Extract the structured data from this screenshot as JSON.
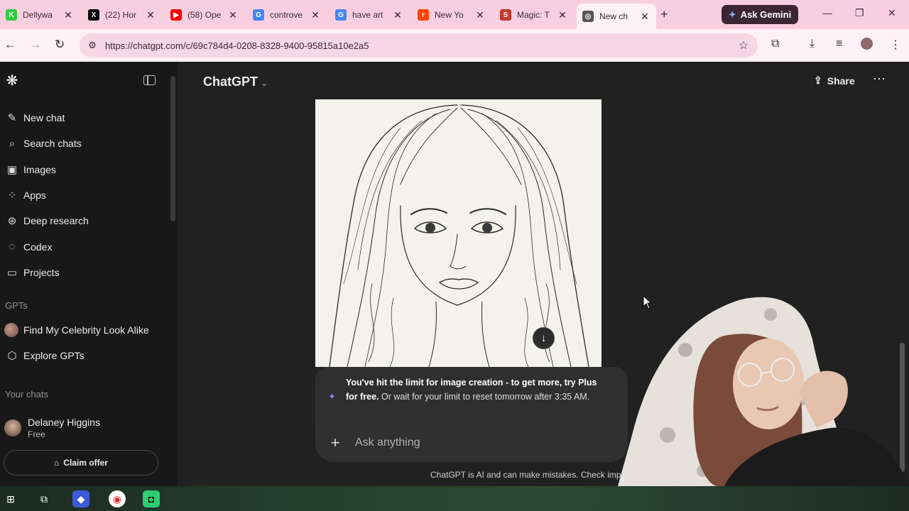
{
  "browser": {
    "tabs": [
      {
        "title": "Dellywa",
        "favicon_letter": "K",
        "favicon_color": "#2ecc40"
      },
      {
        "title": "(22) Hor",
        "favicon_letter": "X",
        "favicon_color": "#000000"
      },
      {
        "title": "(58) Ope",
        "favicon_letter": "▶",
        "favicon_color": "#ff0000"
      },
      {
        "title": "controve",
        "favicon_letter": "G",
        "favicon_color": "#4285f4"
      },
      {
        "title": "have art",
        "favicon_letter": "G",
        "favicon_color": "#4285f4"
      },
      {
        "title": "New Yo",
        "favicon_letter": "r",
        "favicon_color": "#ff4500"
      },
      {
        "title": "Magic: T",
        "favicon_letter": "S",
        "favicon_color": "#c0392b"
      },
      {
        "title": "New ch",
        "favicon_letter": "◎",
        "favicon_color": "#555555"
      }
    ],
    "ask_gemini": "Ask Gemini",
    "url": "https://chatgpt.com/c/69c784d4-0208-8328-9400-95815a10e2a5"
  },
  "sidebar": {
    "nav": [
      {
        "label": "New chat",
        "icon": "✎",
        "icon_name": "new-chat-icon"
      },
      {
        "label": "Search chats",
        "icon": "⌕",
        "icon_name": "search-icon"
      },
      {
        "label": "Images",
        "icon": "▣",
        "icon_name": "images-icon"
      },
      {
        "label": "Apps",
        "icon": "⁘",
        "icon_name": "apps-icon"
      },
      {
        "label": "Deep research",
        "icon": "⊛",
        "icon_name": "deep-research-icon"
      },
      {
        "label": "Codex",
        "icon": "◌",
        "icon_name": "codex-icon"
      },
      {
        "label": "Projects",
        "icon": "▭",
        "icon_name": "projects-icon"
      }
    ],
    "gpts_label": "GPTs",
    "gpts": [
      {
        "label": "Find My Celebrity Look Alike"
      },
      {
        "label": "Explore GPTs"
      }
    ],
    "your_chats_label": "Your chats",
    "user": {
      "name": "Delaney Higgins",
      "plan": "Free"
    },
    "claim_offer": "Claim offer"
  },
  "main": {
    "model": "ChatGPT",
    "share": "Share",
    "limit_message": {
      "bold": "You've hit the limit for image creation - to get more, try Plus for free.",
      "rest": " Or wait for your limit to reset tomorrow after 3:35 AM."
    },
    "composer_placeholder": "Ask anything",
    "disclaimer": "ChatGPT is AI and can make mistakes. Check impo"
  },
  "colors": {
    "chrome_tabstrip": "#f9cfe0",
    "chrome_toolbar": "#fff1f6",
    "sidebar_bg": "#181818",
    "main_bg": "#212121",
    "composer_bg": "#303030",
    "accent_spark": "#8a7bff"
  }
}
